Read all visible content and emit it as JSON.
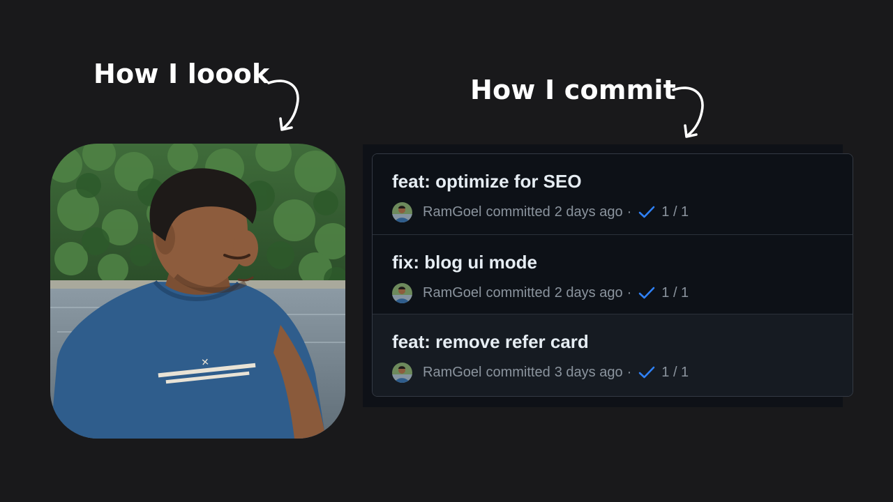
{
  "headings": {
    "look": "How I loook",
    "commit": "How I commit"
  },
  "icons": {
    "arrow": "curved-arrow-down-icon",
    "check": "check-icon"
  },
  "colors": {
    "background": "#19191b",
    "panel": "#0e1117",
    "check": "#2f81f7"
  },
  "commits": [
    {
      "title": "feat: optimize for SEO",
      "author": "RamGoel",
      "verb": "committed",
      "time": "2 days ago",
      "separator": "·",
      "checks": "1 / 1"
    },
    {
      "title": "fix: blog ui mode",
      "author": "RamGoel",
      "verb": "committed",
      "time": "2 days ago",
      "separator": "·",
      "checks": "1 / 1"
    },
    {
      "title": "feat: remove refer card",
      "author": "RamGoel",
      "verb": "committed",
      "time": "3 days ago",
      "separator": "·",
      "checks": "1 / 1"
    }
  ]
}
